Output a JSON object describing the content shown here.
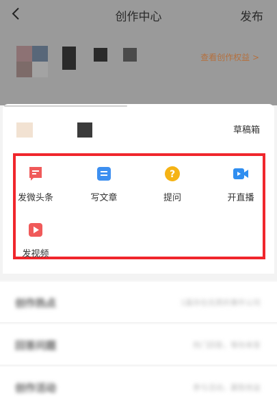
{
  "header": {
    "title": "创作中心",
    "publish_label": "发布"
  },
  "profile": {
    "rights_link": "查看创作权益 >"
  },
  "sheet": {
    "drafts_label": "草稿箱",
    "actions": [
      {
        "label": "发微头条",
        "icon": "micro-post-icon",
        "color": "#f05a5a"
      },
      {
        "label": "写文章",
        "icon": "article-icon",
        "color": "#3d8ff0"
      },
      {
        "label": "提问",
        "icon": "question-icon",
        "color": "#f5b315"
      },
      {
        "label": "开直播",
        "icon": "live-stream-icon",
        "color": "#2f8ef0"
      },
      {
        "label": "发视频",
        "icon": "video-icon",
        "color": "#f05a5a"
      }
    ]
  },
  "list": {
    "rows": [
      {
        "title": "创作热点",
        "subtitle": "1篇存在优质的事件公司"
      },
      {
        "title": "回答问题",
        "subtitle": "热门回答，等你来答"
      },
      {
        "title": "创作活动",
        "subtitle": "参与活动，赢取收益"
      }
    ]
  },
  "colors": {
    "highlight": "#f0262c",
    "link": "#b4703e"
  }
}
